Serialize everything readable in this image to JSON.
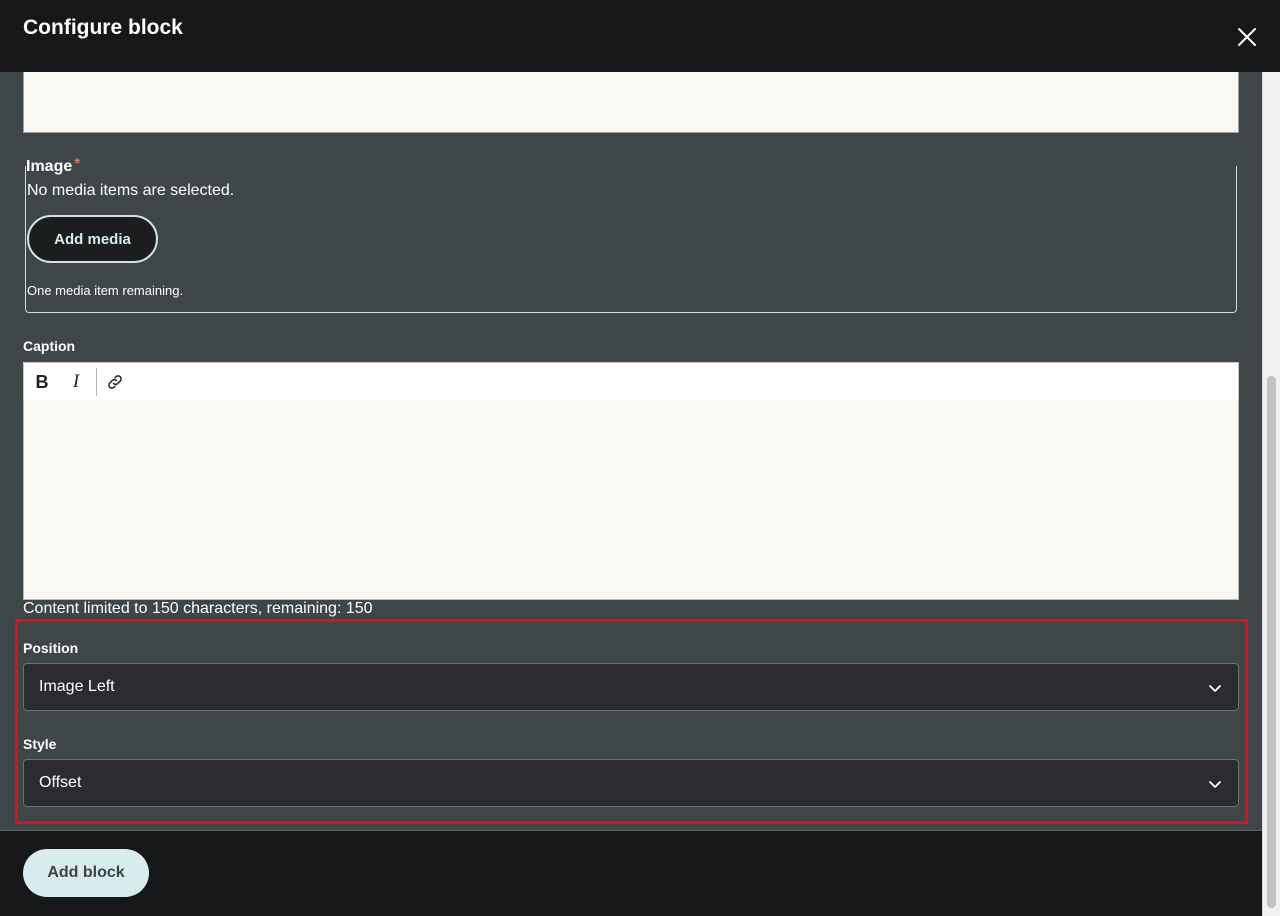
{
  "dialog": {
    "title": "Configure block",
    "close_icon": "close-icon"
  },
  "image_field": {
    "label": "Image",
    "required_marker": "*",
    "empty_text": "No media items are selected.",
    "add_button": "Add media",
    "remaining_text": "One media item remaining."
  },
  "caption_field": {
    "label": "Caption",
    "toolbar": {
      "bold_label": "B",
      "italic_label": "I",
      "link_icon": "link-icon"
    },
    "limit_text": "Content limited to 150 characters, remaining: 150"
  },
  "position_field": {
    "label": "Position",
    "selected": "Image Left"
  },
  "style_field": {
    "label": "Style",
    "selected": "Offset"
  },
  "footer": {
    "submit_label": "Add block"
  },
  "colors": {
    "highlight": "#e0101a",
    "background": "#3e4648",
    "header": "#161718",
    "accent": "#d8eced"
  }
}
